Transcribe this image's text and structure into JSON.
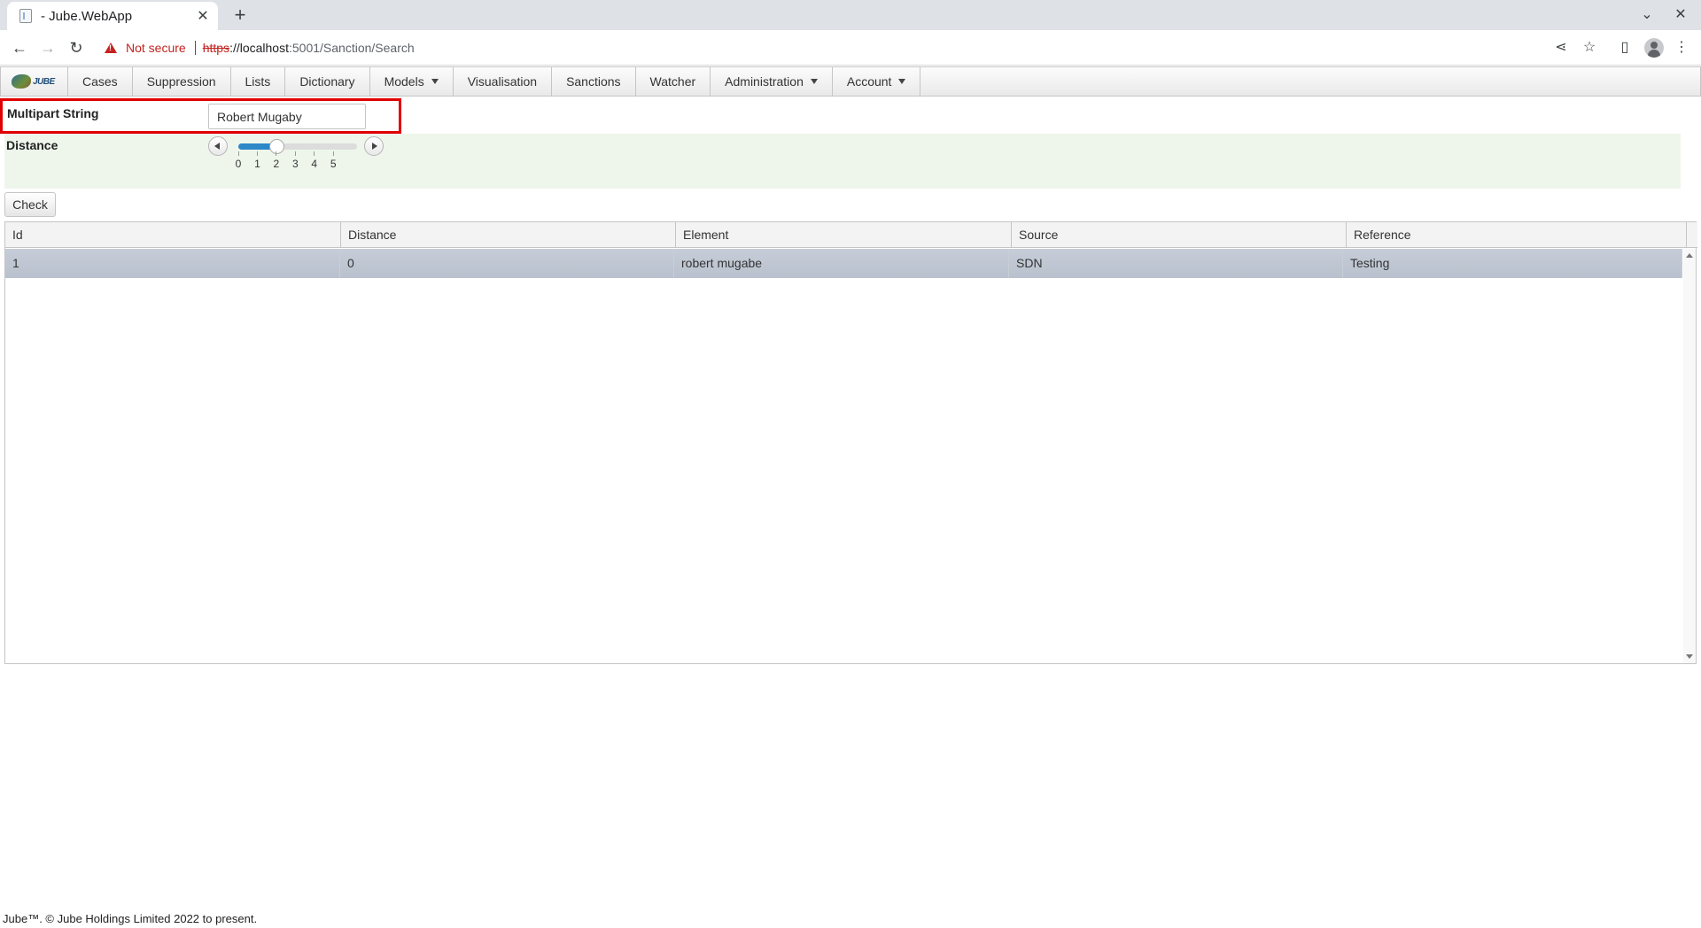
{
  "browser": {
    "tab_title": "- Jube.WebApp",
    "new_tab_symbol": "+",
    "security_label": "Not secure",
    "url_scheme": "https",
    "url_host": "://localhost",
    "url_path": ":5001/Sanction/Search"
  },
  "app": {
    "logo_text": "JUBE",
    "menu": [
      {
        "label": "Cases",
        "dropdown": false
      },
      {
        "label": "Suppression",
        "dropdown": false
      },
      {
        "label": "Lists",
        "dropdown": false
      },
      {
        "label": "Dictionary",
        "dropdown": false
      },
      {
        "label": "Models",
        "dropdown": true
      },
      {
        "label": "Visualisation",
        "dropdown": false
      },
      {
        "label": "Sanctions",
        "dropdown": false
      },
      {
        "label": "Watcher",
        "dropdown": false
      },
      {
        "label": "Administration",
        "dropdown": true
      },
      {
        "label": "Account",
        "dropdown": true
      }
    ]
  },
  "form": {
    "multipart_label": "Multipart String",
    "multipart_value": "Robert Mugaby",
    "distance_label": "Distance",
    "distance_min": 0,
    "distance_max": 5,
    "distance_value": 2,
    "ticks": [
      "0",
      "1",
      "2",
      "3",
      "4",
      "5"
    ],
    "check_label": "Check"
  },
  "grid": {
    "columns": [
      "Id",
      "Distance",
      "Element",
      "Source",
      "Reference"
    ],
    "rows": [
      [
        "1",
        "0",
        "robert mugabe",
        "SDN",
        "Testing"
      ]
    ]
  },
  "footer": "Jube™. © Jube Holdings Limited 2022 to present.",
  "colors": {
    "highlight_border": "#e00000",
    "distance_panel": "#eef6ec",
    "slider_fill": "#2e87c8",
    "selected_row": "#c0c7d3"
  }
}
